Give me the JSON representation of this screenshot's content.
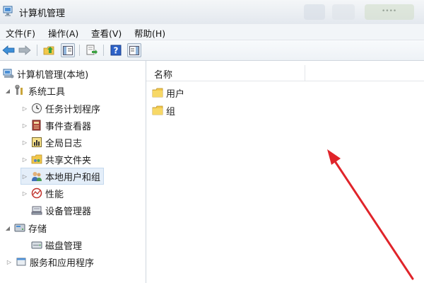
{
  "window": {
    "title": "计算机管理",
    "blurred_text": "••••"
  },
  "menu": {
    "items": [
      {
        "label": "文件(F)"
      },
      {
        "label": "操作(A)"
      },
      {
        "label": "查看(V)"
      },
      {
        "label": "帮助(H)"
      }
    ]
  },
  "toolbar": {
    "icons": [
      "back-arrow-icon",
      "forward-arrow-icon",
      "up-folder-icon",
      "show-hide-tree-icon",
      "export-list-icon",
      "help-icon",
      "show-hide-action-pane-icon"
    ]
  },
  "tree": {
    "items": [
      {
        "label": "计算机管理(本地)",
        "icon": "computer-management-icon"
      },
      {
        "label": "系统工具",
        "icon": "system-tools-icon"
      },
      {
        "label": "任务计划程序",
        "icon": "task-scheduler-icon"
      },
      {
        "label": "事件查看器",
        "icon": "event-viewer-icon"
      },
      {
        "label": "全局日志",
        "icon": "global-log-icon"
      },
      {
        "label": "共享文件夹",
        "icon": "shared-folders-icon"
      },
      {
        "label": "本地用户和组",
        "icon": "local-users-groups-icon"
      },
      {
        "label": "性能",
        "icon": "performance-icon"
      },
      {
        "label": "设备管理器",
        "icon": "device-manager-icon"
      },
      {
        "label": "存储",
        "icon": "storage-icon"
      },
      {
        "label": "磁盘管理",
        "icon": "disk-management-icon"
      },
      {
        "label": "服务和应用程序",
        "icon": "services-applications-icon"
      }
    ],
    "selected_index": 6
  },
  "main": {
    "column_header": "名称",
    "rows": [
      {
        "label": "用户",
        "icon": "folder-icon"
      },
      {
        "label": "组",
        "icon": "folder-icon"
      }
    ]
  },
  "colors": {
    "annotation_arrow": "#e0242a",
    "selection": "#e4eef9",
    "folder": "#f2c84b"
  }
}
